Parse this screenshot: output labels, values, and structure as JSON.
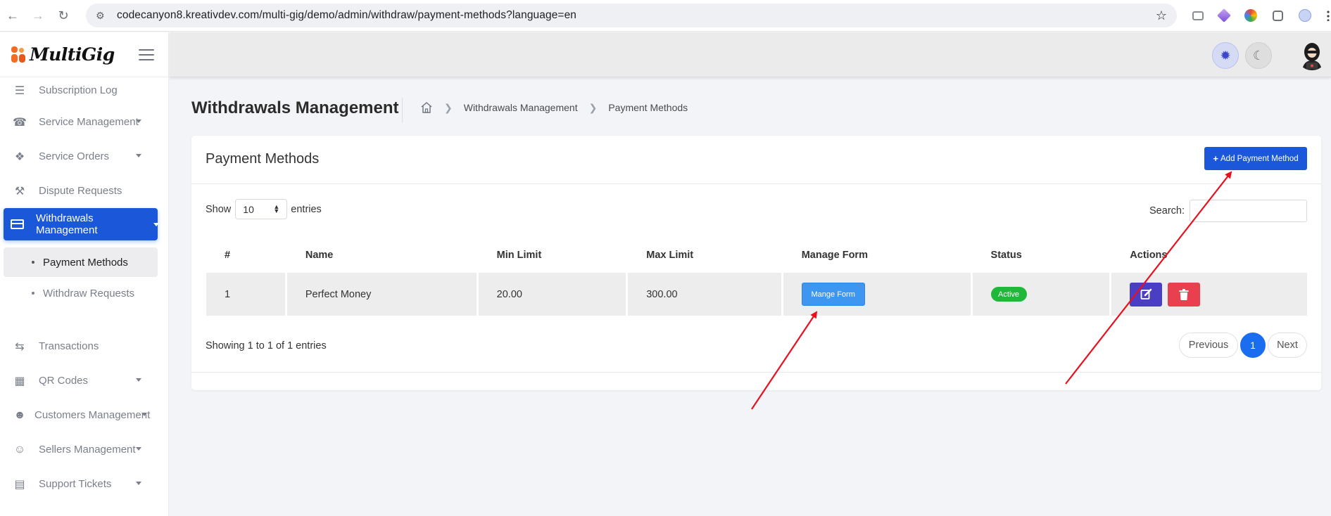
{
  "browser": {
    "url": "codecanyon8.kreativdev.com/multi-gig/demo/admin/withdraw/payment-methods?language=en"
  },
  "brand": {
    "name": "MultiGig"
  },
  "sidebar": {
    "items": [
      {
        "label": "Subscription Log",
        "icon": "list-icon",
        "has_caret": false
      },
      {
        "label": "Service Management",
        "icon": "headset-icon",
        "has_caret": true
      },
      {
        "label": "Service Orders",
        "icon": "boxes-icon",
        "has_caret": true
      },
      {
        "label": "Dispute Requests",
        "icon": "gavel-icon",
        "has_caret": false
      },
      {
        "label": "Withdrawals Management",
        "icon": "credit-card-icon",
        "has_caret": true,
        "active": true
      },
      {
        "label": "Transactions",
        "icon": "exchange-icon",
        "has_caret": false
      },
      {
        "label": "QR Codes",
        "icon": "qrcode-icon",
        "has_caret": true
      },
      {
        "label": "Customers Management",
        "icon": "users-icon",
        "has_caret": true
      },
      {
        "label": "Sellers Management",
        "icon": "user-tie-icon",
        "has_caret": true
      },
      {
        "label": "Support Tickets",
        "icon": "ticket-icon",
        "has_caret": true
      }
    ],
    "sub_items": [
      {
        "label": "Payment Methods",
        "active": true
      },
      {
        "label": "Withdraw Requests",
        "active": false
      }
    ]
  },
  "page": {
    "title": "Withdrawals Management",
    "breadcrumb": [
      "Withdrawals Management",
      "Payment Methods"
    ]
  },
  "card": {
    "title": "Payment Methods",
    "add_button": "Add Payment Method",
    "show_label": "Show",
    "entries_value": "10",
    "entries_label": "entries",
    "search_label": "Search:",
    "search_value": ""
  },
  "table": {
    "headers": [
      "#",
      "Name",
      "Min Limit",
      "Max Limit",
      "Manage Form",
      "Status",
      "Actions"
    ],
    "rows": [
      {
        "index": "1",
        "name": "Perfect Money",
        "min": "20.00",
        "max": "300.00",
        "manage": "Mange Form",
        "status": "Active"
      }
    ]
  },
  "footer": {
    "info": "Showing 1 to 1 of 1 entries",
    "prev": "Previous",
    "page": "1",
    "next": "Next"
  },
  "colors": {
    "primary": "#1b58d9",
    "manage_button": "#3d96f0",
    "status_active": "#1fb83a",
    "edit_button": "#4a3fc4",
    "delete_button": "#e8404e",
    "annotation_arrow": "#e8101c"
  }
}
